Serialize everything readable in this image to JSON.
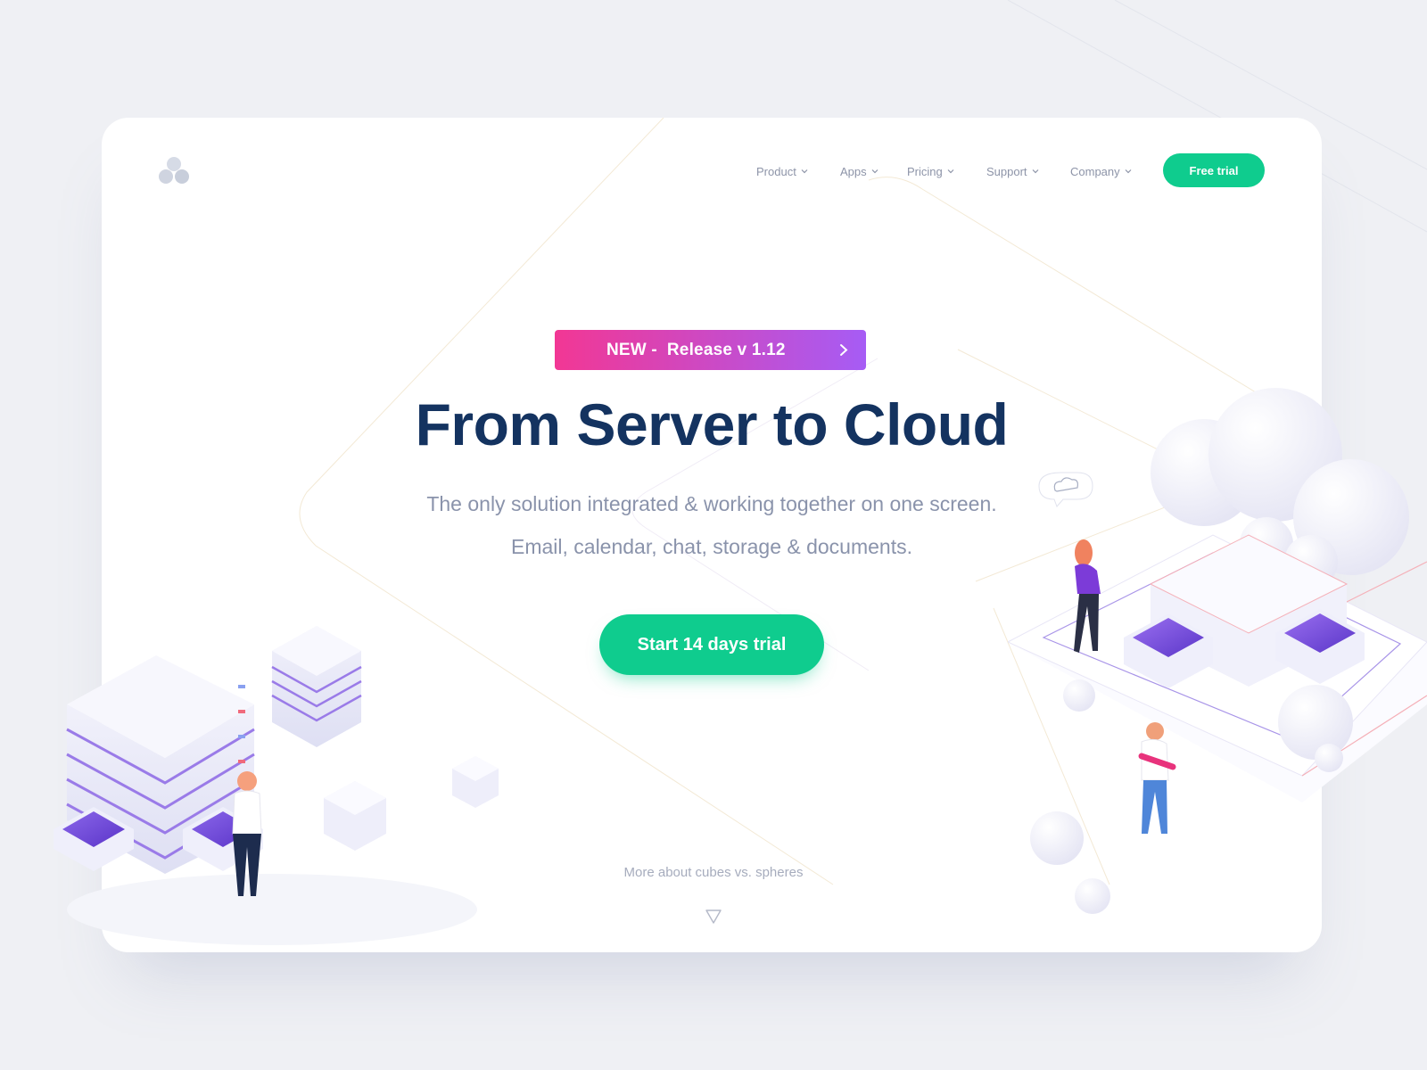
{
  "brand": {
    "logo_icon": "three-circles-logo-icon"
  },
  "nav": {
    "items": [
      {
        "label": "Product"
      },
      {
        "label": "Apps"
      },
      {
        "label": "Pricing"
      },
      {
        "label": "Support"
      },
      {
        "label": "Company"
      }
    ],
    "free_trial_label": "Free trial"
  },
  "hero": {
    "badge_text": "NEW -  Release v 1.12",
    "headline": "From Server to Cloud",
    "subline_1": "The only solution integrated & working together on one screen.",
    "subline_2": "Email, calendar, chat, storage & documents.",
    "cta_label": "Start 14 days trial"
  },
  "footer": {
    "more_link": "More about cubes vs. spheres"
  },
  "colors": {
    "accent": "#0fcc8e",
    "headline": "#143360",
    "badge_from": "#f23794",
    "badge_to": "#a65cf5",
    "background": "#eff0f4"
  }
}
